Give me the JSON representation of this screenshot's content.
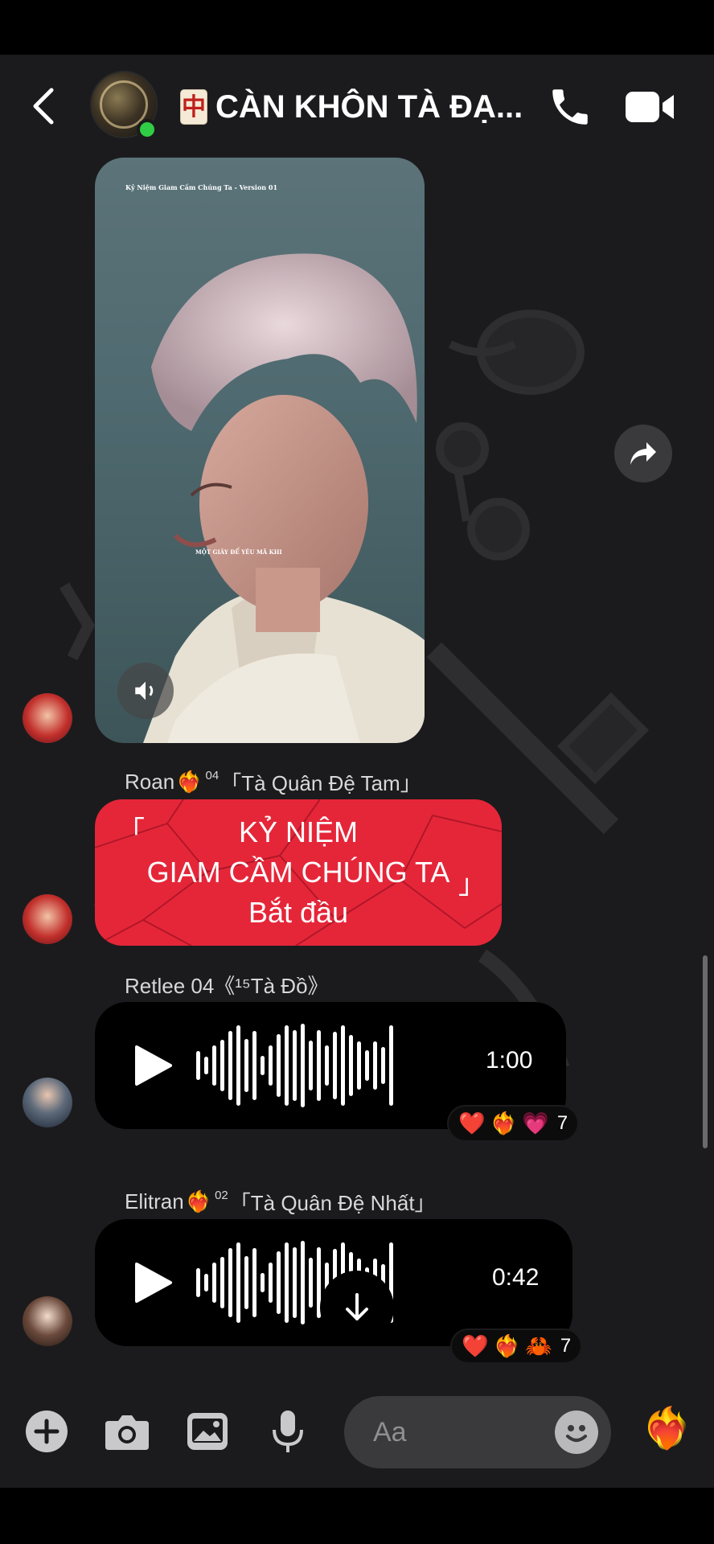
{
  "header": {
    "title": "CÀN KHÔN TÀ ĐẠ...",
    "title_icon": "mahjong-red-dragon",
    "title_icon_glyph": "中",
    "online": true
  },
  "messages": {
    "video": {
      "caption_top": "Kỷ Niệm Giam Cầm Chúng Ta - Version 01",
      "caption_mid": "MỘT GIÂY ĐỂ YÊU MÃ KHI",
      "muted_icon": "speaker-icon"
    },
    "red_card": {
      "sender": "Roan",
      "sender_badge": "04",
      "sender_title": "「Tà Quân Đệ Tam」",
      "open_bracket": "「",
      "close_bracket": "」",
      "line1": "KỶ NIỆM",
      "line2": "GIAM CẦM CHÚNG TA",
      "line3": "Bắt đầu"
    },
    "audio1": {
      "sender": "Retlee  04《¹⁵Tà Đồ》",
      "duration": "1:00",
      "reactions": [
        "❤️",
        "❤️‍🔥",
        "💗"
      ],
      "reaction_count": "7"
    },
    "audio2": {
      "sender": "Elitran",
      "sender_badge": "02",
      "sender_title": "「Tà Quân Đệ Nhất」",
      "duration": "0:42",
      "reactions": [
        "❤️",
        "❤️‍🔥",
        "🦀"
      ],
      "reaction_count": "7"
    }
  },
  "composer": {
    "placeholder": "Aa",
    "quick_reaction": "❤️‍🔥"
  },
  "colors": {
    "background": "#1b1b1d",
    "red_card": "#e52639",
    "online": "#31cc46",
    "bubble_dark": "#000000"
  }
}
